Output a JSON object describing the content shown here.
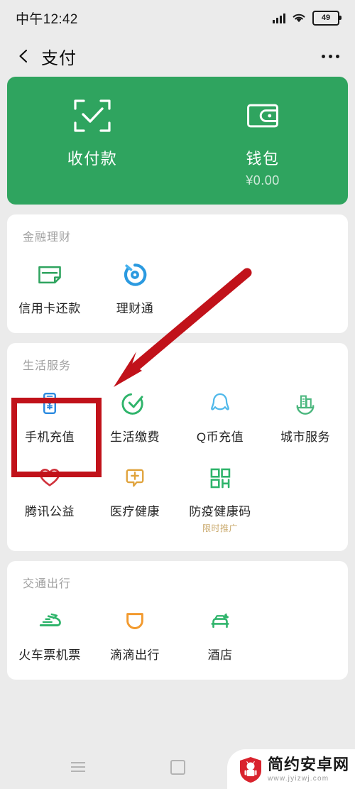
{
  "status_bar": {
    "time": "中午12:42",
    "signal_icon": "signal-bars-icon",
    "wifi_icon": "wifi-icon",
    "battery_icon": "battery-icon",
    "battery_level": "49"
  },
  "nav_bar": {
    "back_icon": "back-chevron-icon",
    "title": "支付",
    "more_icon": "more-options-icon"
  },
  "hero": {
    "background_color": "#2fa45f",
    "items": [
      {
        "icon": "scan-qr-icon",
        "label": "收付款",
        "sub": ""
      },
      {
        "icon": "wallet-icon",
        "label": "钱包",
        "sub": "¥0.00"
      }
    ]
  },
  "sections": [
    {
      "title": "金融理财",
      "items": [
        {
          "icon": "credit-card-icon",
          "label": "信用卡还款",
          "sub": "",
          "color": "#2fa45f"
        },
        {
          "icon": "wealth-circle-icon",
          "label": "理财通",
          "sub": "",
          "color": "#2b9ae0"
        }
      ]
    },
    {
      "title": "生活服务",
      "items": [
        {
          "icon": "phone-recharge-icon",
          "label": "手机充值",
          "sub": "",
          "color": "#2b8ae0"
        },
        {
          "icon": "check-circle-icon",
          "label": "生活缴费",
          "sub": "",
          "color": "#2fb46b"
        },
        {
          "icon": "qq-penguin-icon",
          "label": "Q币充值",
          "sub": "",
          "color": "#4fb8ea"
        },
        {
          "icon": "city-buildings-icon",
          "label": "城市服务",
          "sub": "",
          "color": "#4bb77e"
        },
        {
          "icon": "heart-charity-icon",
          "label": "腾讯公益",
          "sub": "",
          "color": "#d0323c"
        },
        {
          "icon": "medical-cross-icon",
          "label": "医疗健康",
          "sub": "",
          "color": "#e0a33c"
        },
        {
          "icon": "health-qr-icon",
          "label": "防疫健康码",
          "sub": "限时推广",
          "color": "#2fb46b"
        }
      ]
    },
    {
      "title": "交通出行",
      "items": [
        {
          "icon": "train-plane-icon",
          "label": "火车票机票",
          "sub": "",
          "color": "#2fb46b"
        },
        {
          "icon": "didi-shield-icon",
          "label": "滴滴出行",
          "sub": "",
          "color": "#f29a2e"
        },
        {
          "icon": "hotel-bed-icon",
          "label": "酒店",
          "sub": "",
          "color": "#2fb46b"
        }
      ]
    }
  ],
  "annotations": {
    "arrow_color": "#c1121a",
    "highlight_box_color": "#c1121a",
    "highlight_target": "手机充值"
  },
  "bottom_nav": {
    "menu_icon": "menu-lines-icon",
    "home_icon": "home-square-icon",
    "back_icon": "back-chevron-icon"
  },
  "watermark": {
    "logo_icon": "android-shield-logo-icon",
    "title": "简约安卓网",
    "url": "www.jyizwj.com"
  }
}
